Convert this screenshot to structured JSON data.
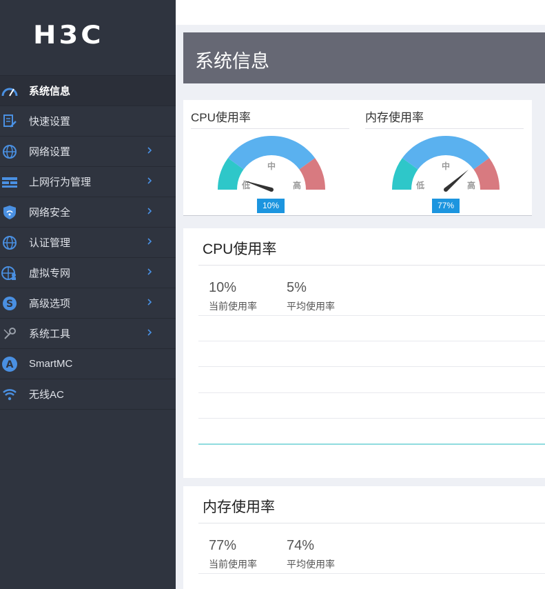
{
  "brand": {
    "logo_text": "H3C"
  },
  "sidebar": {
    "items": [
      {
        "label": "系统信息",
        "icon": "speedometer-icon",
        "active": true,
        "has_submenu": false
      },
      {
        "label": "快速设置",
        "icon": "document-edit-icon",
        "active": false,
        "has_submenu": false
      },
      {
        "label": "网络设置",
        "icon": "globe-icon",
        "active": false,
        "has_submenu": true
      },
      {
        "label": "上网行为管理",
        "icon": "firewall-icon",
        "active": false,
        "has_submenu": true
      },
      {
        "label": "网络安全",
        "icon": "shield-wifi-icon",
        "active": false,
        "has_submenu": true
      },
      {
        "label": "认证管理",
        "icon": "globe-icon",
        "active": false,
        "has_submenu": true
      },
      {
        "label": "虚拟专网",
        "icon": "globe-person-icon",
        "active": false,
        "has_submenu": true
      },
      {
        "label": "高级选项",
        "icon": "s-circle-icon",
        "active": false,
        "has_submenu": true
      },
      {
        "label": "系统工具",
        "icon": "tools-icon",
        "active": false,
        "has_submenu": true
      },
      {
        "label": "SmartMC",
        "icon": "a-circle-icon",
        "active": false,
        "has_submenu": false
      },
      {
        "label": "无线AC",
        "icon": "wifi-icon",
        "active": false,
        "has_submenu": false
      }
    ]
  },
  "page": {
    "title": "系统信息"
  },
  "gauges": [
    {
      "title": "CPU使用率",
      "value_label": "10%",
      "value": 10,
      "low": "低",
      "mid": "中",
      "high": "高"
    },
    {
      "title": "内存使用率",
      "value_label": "77%",
      "value": 77,
      "low": "低",
      "mid": "中",
      "high": "高"
    }
  ],
  "cpu_panel": {
    "title": "CPU使用率",
    "current_value": "10%",
    "current_label": "当前使用率",
    "average_value": "5%",
    "average_label": "平均使用率"
  },
  "memory_panel": {
    "title": "内存使用率",
    "current_value": "77%",
    "current_label": "当前使用率",
    "average_value": "74%",
    "average_label": "平均使用率"
  },
  "colors": {
    "sidebar_bg": "#2f343f",
    "title_bar": "#666874",
    "gauge_low": "#2ec7c9",
    "gauge_mid": "#5ab1ef",
    "gauge_high": "#d87a80",
    "badge": "#1c95df",
    "accent_icon": "#4a90e2"
  }
}
